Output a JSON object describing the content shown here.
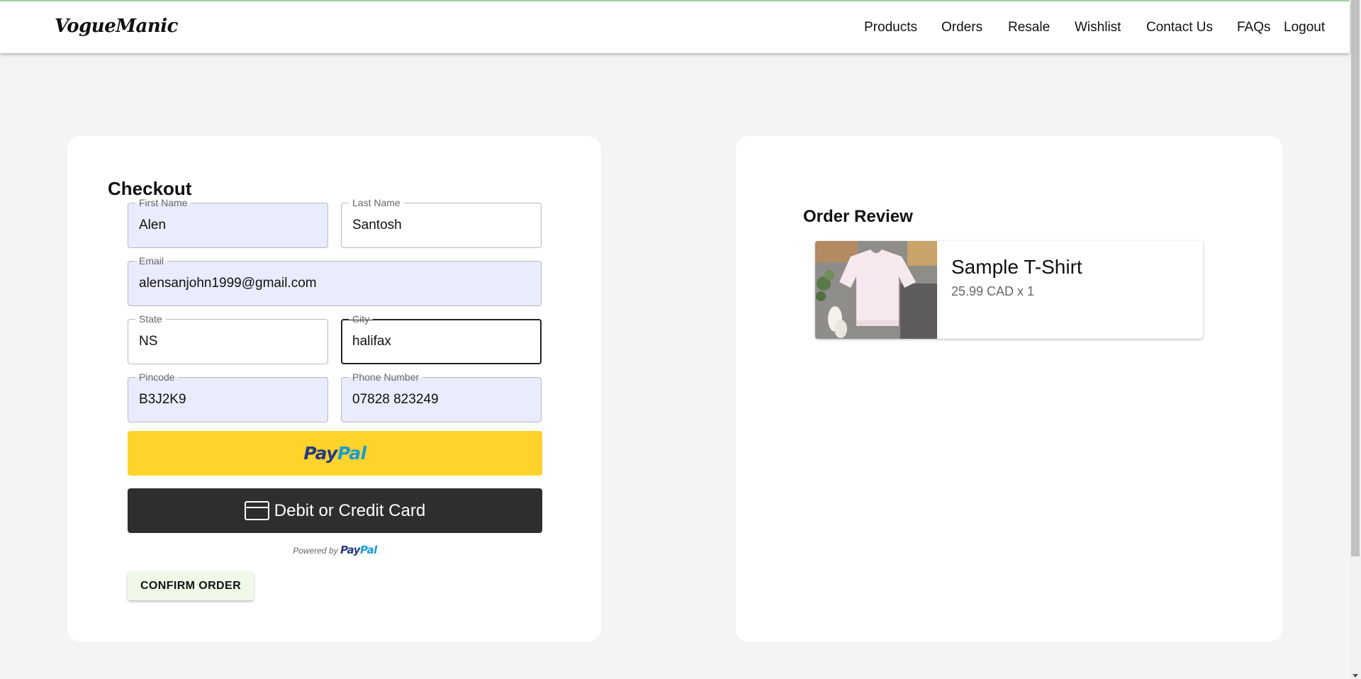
{
  "brand": "VogueManic",
  "nav": [
    {
      "label": "Products"
    },
    {
      "label": "Orders"
    },
    {
      "label": "Resale"
    },
    {
      "label": "Wishlist"
    },
    {
      "label": "Contact Us"
    },
    {
      "label": "FAQs"
    },
    {
      "label": "Logout"
    }
  ],
  "checkout": {
    "title": "Checkout",
    "fields": {
      "first_name": {
        "label": "First Name",
        "value": "Alen"
      },
      "last_name": {
        "label": "Last Name",
        "value": "Santosh"
      },
      "email": {
        "label": "Email",
        "value": "alensanjohn1999@gmail.com"
      },
      "state": {
        "label": "State",
        "value": "NS"
      },
      "city": {
        "label": "City",
        "value": "halifax"
      },
      "pincode": {
        "label": "Pincode",
        "value": "B3J2K9"
      },
      "phone": {
        "label": "Phone Number",
        "value": "07828 823249"
      }
    },
    "paypal": {
      "logo_part1": "Pay",
      "logo_part2": "Pal",
      "card_button_label": "Debit or Credit Card",
      "powered_by": "Powered by"
    },
    "confirm_label": "CONFIRM ORDER"
  },
  "review": {
    "title": "Order Review",
    "items": [
      {
        "name": "Sample T-Shirt",
        "price_line": "25.99 CAD x 1"
      }
    ]
  },
  "colors": {
    "paypal_yellow": "#ffd32a",
    "paypal_dark": "#2c2e2f",
    "autofill": "#e8ecfc",
    "page_bg": "#f4f4f4"
  }
}
